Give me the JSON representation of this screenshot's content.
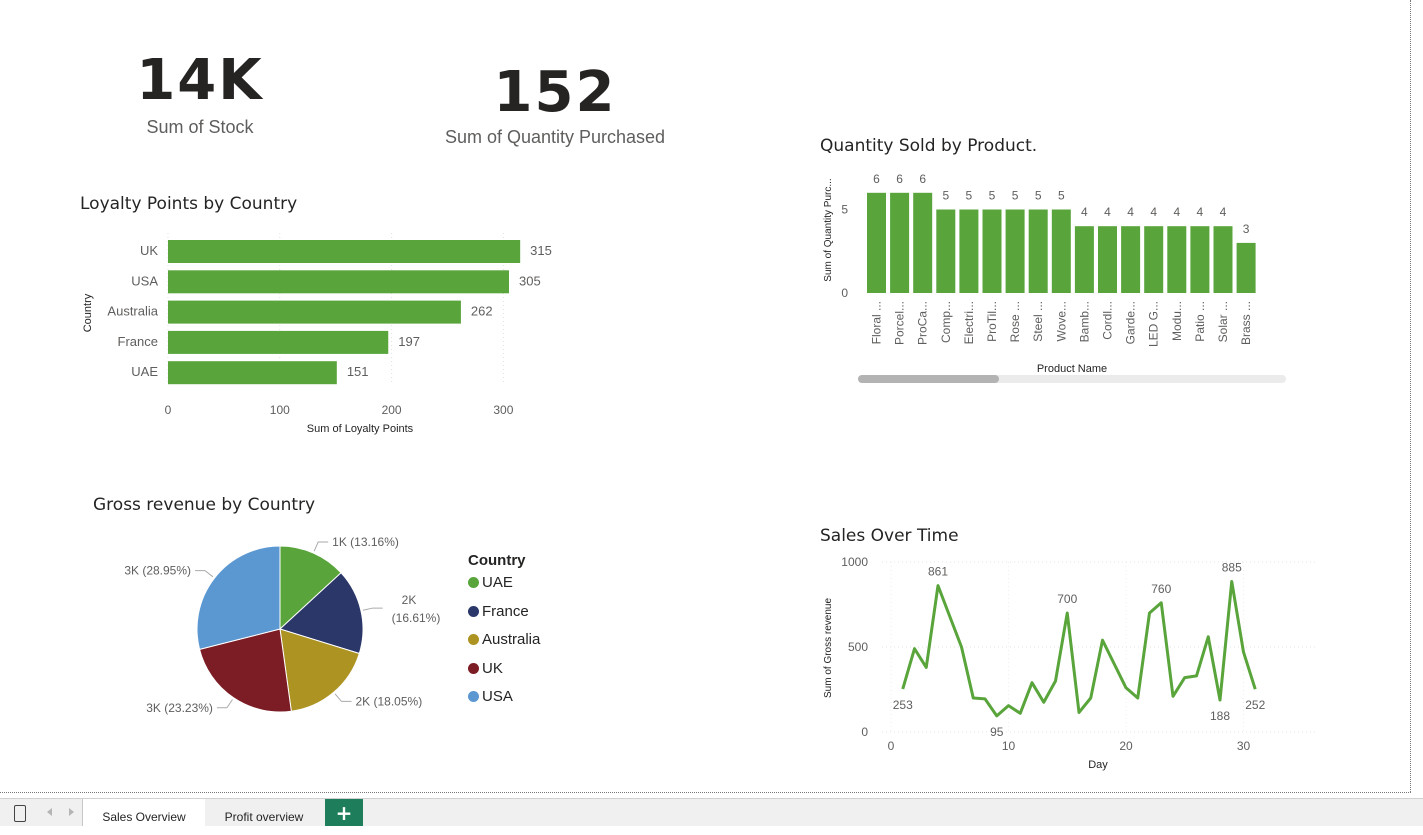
{
  "cards": [
    {
      "value": "14K",
      "label": "Sum of  Stock"
    },
    {
      "value": "152",
      "label": "Sum of Quantity Purchased"
    }
  ],
  "colors": {
    "bar": "#59a53b",
    "line": "#59a53b",
    "tab_add": "#1e7e5b"
  },
  "loyalty": {
    "title": "Loyalty Points by Country",
    "xlabel": "Sum of Loyalty Points",
    "ylabel": "Country"
  },
  "quantity": {
    "title": "Quantity Sold by Product.",
    "xlabel": "Product Name",
    "ylabel": "Sum of Quantity Purc..."
  },
  "revenue": {
    "title": "Gross revenue by Country",
    "legend_title": "Country"
  },
  "sales": {
    "title": "Sales Over Time",
    "xlabel": "Day",
    "ylabel": "Sum of Gross revenue"
  },
  "tabs": {
    "items": [
      {
        "label": "Sales Overview",
        "active": true
      },
      {
        "label": "Profit overview",
        "active": false
      }
    ],
    "add_label": "+"
  },
  "chart_data": [
    {
      "type": "bar",
      "orientation": "horizontal",
      "title": "Loyalty Points by Country",
      "categories": [
        "UK",
        "USA",
        "Australia",
        "France",
        "UAE"
      ],
      "values": [
        315,
        305,
        262,
        197,
        151
      ],
      "data_labels": [
        "315",
        "305",
        "262",
        "197",
        "151"
      ],
      "xlabel": "Sum of Loyalty Points",
      "ylabel": "Country",
      "xlim": [
        0,
        300
      ],
      "xticks": [
        0,
        100,
        200,
        300
      ],
      "xtick_labels": [
        "0",
        "100",
        "200",
        "300"
      ]
    },
    {
      "type": "bar",
      "title": "Quantity Sold by Product.",
      "categories": [
        "Floral ...",
        "Porcel...",
        "ProCa...",
        "Comp...",
        "Electri...",
        "ProTil...",
        "Rose ...",
        "Steel ...",
        "Wove...",
        "Bamb...",
        "Cordl...",
        "Garde...",
        "LED G...",
        "Modu...",
        "Patio ...",
        "Solar ...",
        "Brass ..."
      ],
      "values": [
        6,
        6,
        6,
        5,
        5,
        5,
        5,
        5,
        5,
        4,
        4,
        4,
        4,
        4,
        4,
        4,
        3
      ],
      "data_labels": [
        "6",
        "6",
        "6",
        "5",
        "5",
        "5",
        "5",
        "5",
        "5",
        "4",
        "4",
        "4",
        "4",
        "4",
        "4",
        "4",
        "3"
      ],
      "xlabel": "Product Name",
      "ylabel": "Sum of Quantity Purc...",
      "ylim": [
        0,
        6
      ],
      "yticks": [
        0,
        5
      ],
      "ytick_labels": [
        "0",
        "5"
      ]
    },
    {
      "type": "pie",
      "title": "Gross revenue by Country",
      "legend_title": "Country",
      "slices": [
        {
          "name": "UAE",
          "percent": 13.16,
          "label": "1K (13.16%)",
          "color": "#59a53b"
        },
        {
          "name": "France",
          "percent": 16.61,
          "label_lines": [
            "2K",
            "(16.61%)"
          ],
          "color": "#2a3768"
        },
        {
          "name": "Australia",
          "percent": 18.05,
          "label": "2K (18.05%)",
          "color": "#ad9321"
        },
        {
          "name": "UK",
          "percent": 23.23,
          "label": "3K (23.23%)",
          "color": "#7c1c24"
        },
        {
          "name": "USA",
          "percent": 28.95,
          "label": "3K (28.95%)",
          "color": "#5b97d1"
        }
      ]
    },
    {
      "type": "line",
      "title": "Sales Over Time",
      "xlabel": "Day",
      "ylabel": "Sum of Gross revenue",
      "x": [
        1,
        2,
        3,
        4,
        5,
        6,
        7,
        8,
        9,
        10,
        11,
        12,
        13,
        14,
        15,
        16,
        17,
        18,
        19,
        20,
        21,
        22,
        23,
        24,
        25,
        26,
        27,
        28,
        29,
        30,
        31
      ],
      "y": [
        253,
        490,
        380,
        861,
        680,
        500,
        200,
        195,
        95,
        155,
        110,
        290,
        175,
        300,
        700,
        115,
        200,
        540,
        400,
        260,
        200,
        700,
        760,
        210,
        320,
        330,
        560,
        188,
        885,
        470,
        252
      ],
      "point_labels": [
        {
          "x": 1,
          "text": "253"
        },
        {
          "x": 4,
          "text": "861"
        },
        {
          "x": 9,
          "text": "95"
        },
        {
          "x": 15,
          "text": "700"
        },
        {
          "x": 23,
          "text": "760"
        },
        {
          "x": 28,
          "text": "188"
        },
        {
          "x": 29,
          "text": "885"
        },
        {
          "x": 31,
          "text": "252"
        }
      ],
      "xlim": [
        0,
        32
      ],
      "ylim": [
        0,
        1000
      ],
      "xticks": [
        0,
        10,
        20,
        30
      ],
      "xtick_labels": [
        "0",
        "10",
        "20",
        "30"
      ],
      "yticks": [
        0,
        500,
        1000
      ],
      "ytick_labels": [
        "0",
        "500",
        "1000"
      ]
    }
  ]
}
